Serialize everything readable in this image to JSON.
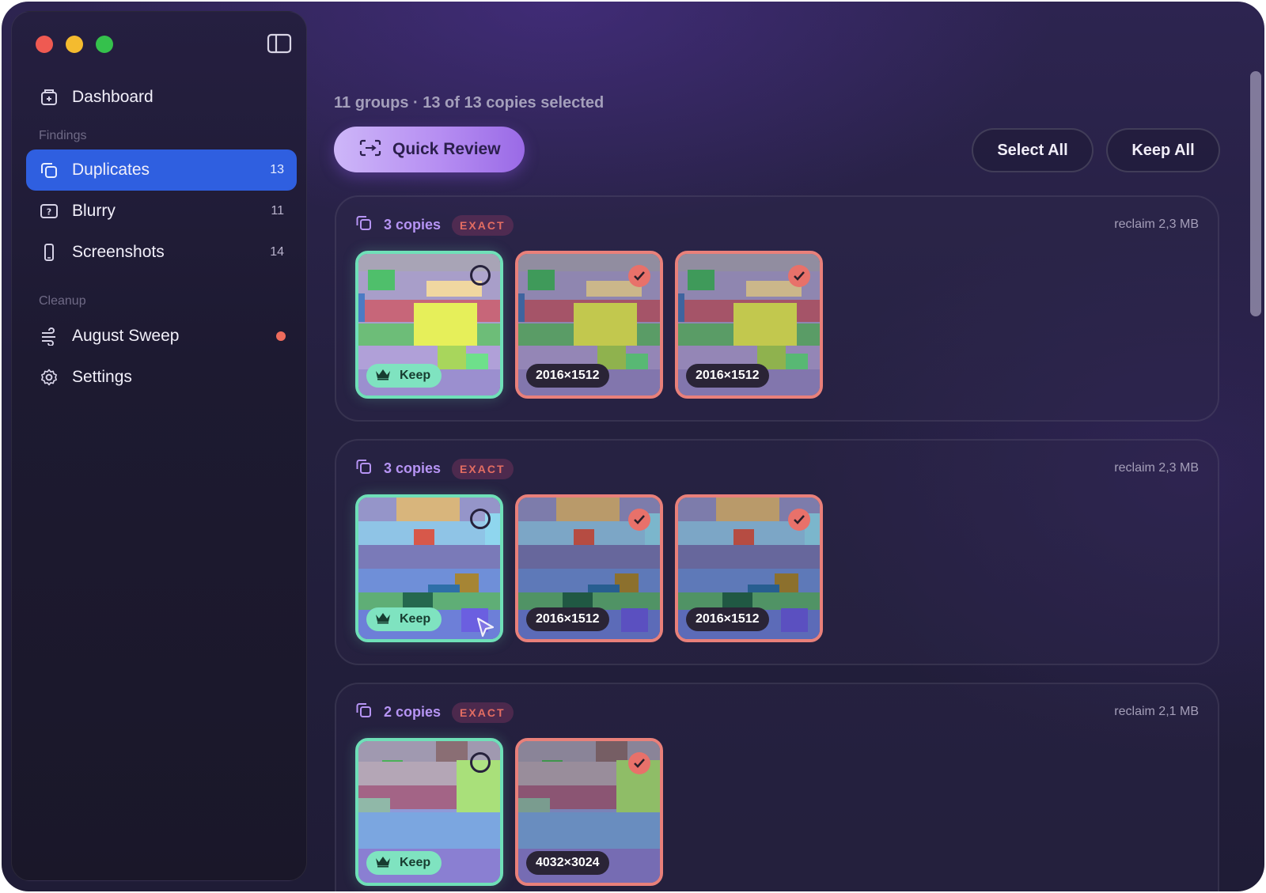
{
  "sidebar": {
    "items": [
      {
        "label": "Dashboard",
        "icon": "dashboard-icon"
      },
      {
        "label": "Duplicates",
        "icon": "duplicates-icon",
        "count": "13",
        "active": true
      },
      {
        "label": "Blurry",
        "icon": "blurry-icon",
        "count": "11"
      },
      {
        "label": "Screenshots",
        "icon": "screenshot-icon",
        "count": "14"
      },
      {
        "label": "August Sweep",
        "icon": "sweep-icon",
        "has_dot": true
      },
      {
        "label": "Settings",
        "icon": "gear-icon"
      }
    ],
    "sections": {
      "findings": "Findings",
      "cleanup": "Cleanup"
    }
  },
  "main": {
    "summary": "11 groups · 13 of 13 copies selected",
    "quick_review_label": "Quick Review",
    "select_all_label": "Select All",
    "keep_all_label": "Keep All"
  },
  "groups": [
    {
      "copies": "3 copies",
      "badge": "EXACT",
      "reclaim": "reclaim 2,3 MB",
      "items": [
        {
          "state": "keep",
          "tag": "Keep"
        },
        {
          "state": "selected",
          "tag": "2016×1512"
        },
        {
          "state": "selected",
          "tag": "2016×1512"
        }
      ]
    },
    {
      "copies": "3 copies",
      "badge": "EXACT",
      "reclaim": "reclaim 2,3 MB",
      "items": [
        {
          "state": "keep",
          "tag": "Keep"
        },
        {
          "state": "selected",
          "tag": "2016×1512"
        },
        {
          "state": "selected",
          "tag": "2016×1512"
        }
      ]
    },
    {
      "copies": "2 copies",
      "badge": "EXACT",
      "reclaim": "reclaim 2,1 MB",
      "items": [
        {
          "state": "keep",
          "tag": "Keep"
        },
        {
          "state": "selected",
          "tag": "4032×3024"
        }
      ]
    }
  ],
  "colors": {
    "accent": "#2f5fe0",
    "keep": "#6fe0b8",
    "selected": "#e9807a",
    "purple": "#b694f4"
  }
}
